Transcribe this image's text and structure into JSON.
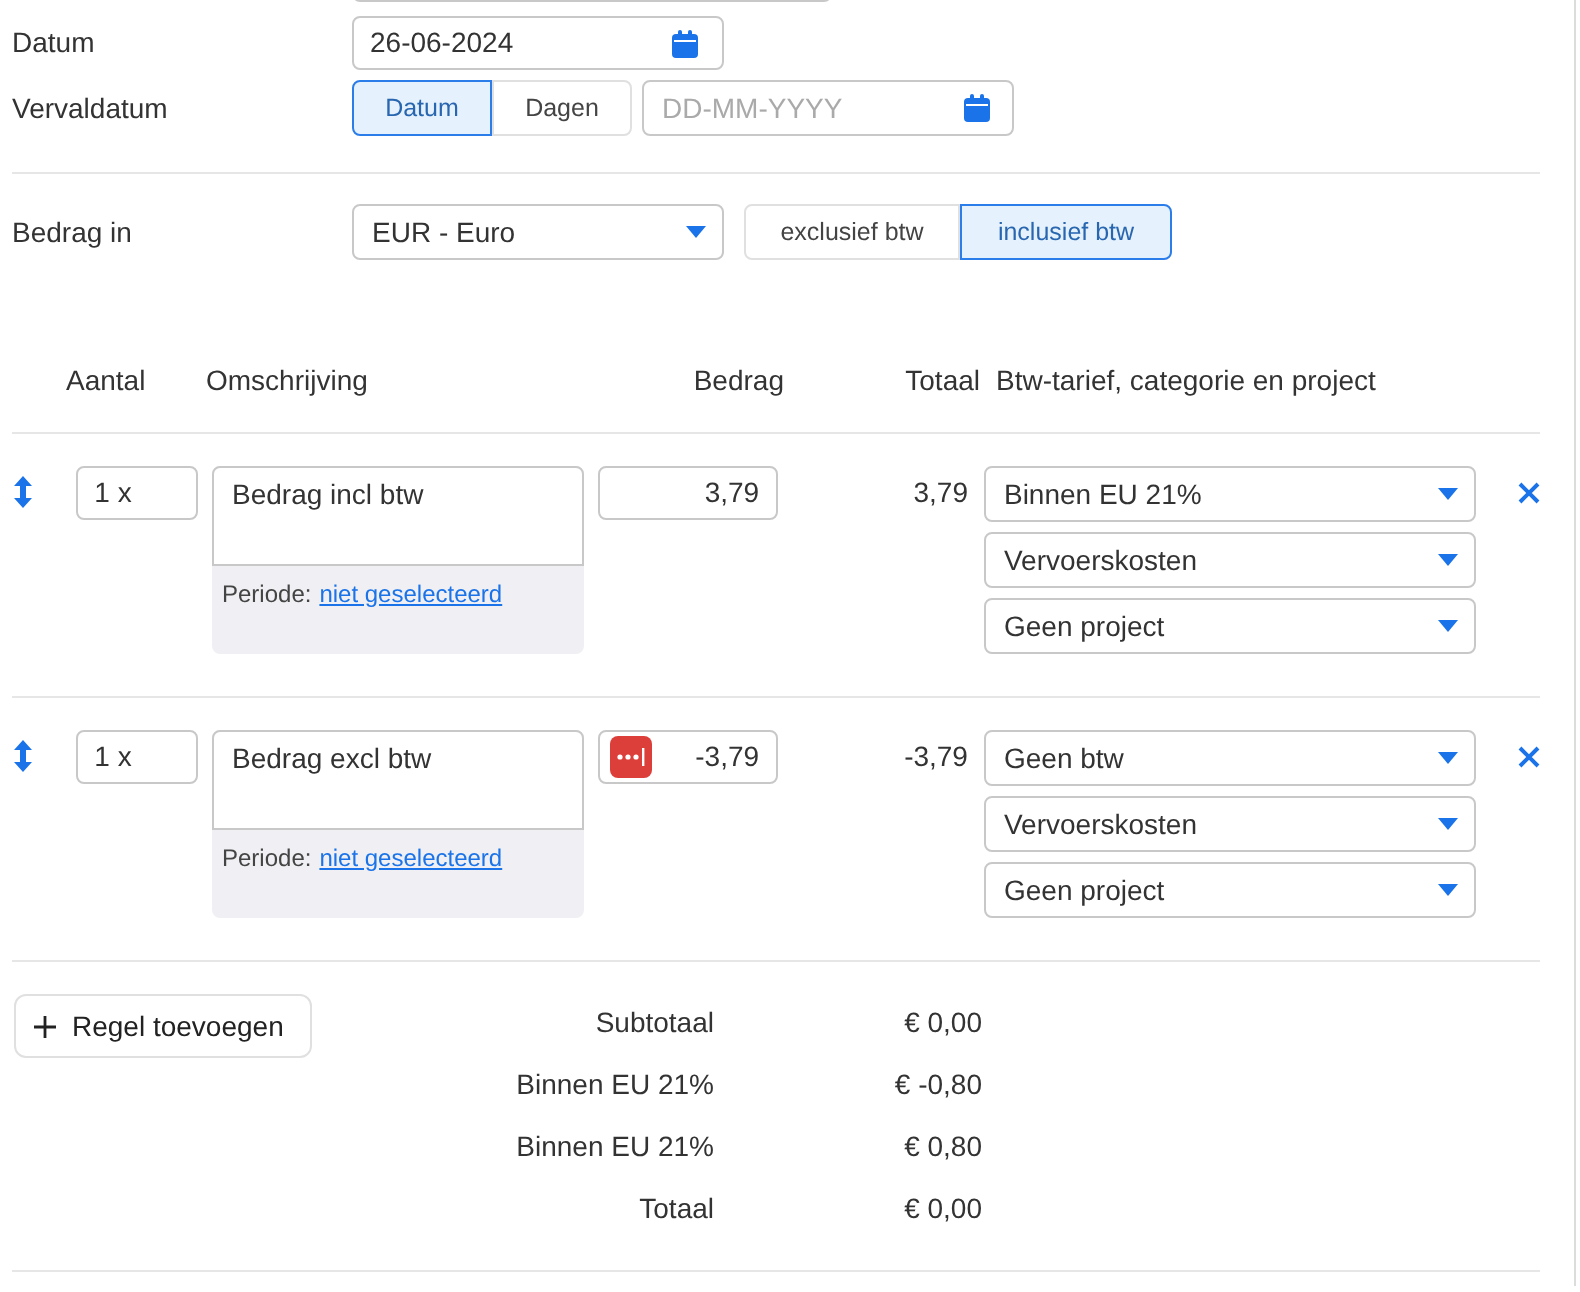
{
  "datum": {
    "label": "Datum",
    "value": "26-06-2024"
  },
  "vervaldatum": {
    "label": "Vervaldatum",
    "modes": [
      {
        "label": "Datum",
        "selected": true
      },
      {
        "label": "Dagen",
        "selected": false
      }
    ],
    "placeholder": "DD-MM-YYYY"
  },
  "bedrag_in": {
    "label": "Bedrag in",
    "currency": "EUR - Euro",
    "modes": [
      {
        "label": "exclusief btw",
        "selected": false
      },
      {
        "label": "inclusief btw",
        "selected": true
      }
    ]
  },
  "table": {
    "columns": [
      "Aantal",
      "Omschrijving",
      "Bedrag",
      "Totaal",
      "Btw-tarief, categorie en project"
    ],
    "rows": [
      {
        "quantity": "1 x",
        "description": "Bedrag incl btw",
        "period_label": "Periode:",
        "period_link": "niet geselecteerd",
        "amount": "3,79",
        "autofill_badge": false,
        "total": "3,79",
        "vat": "Binnen EU 21%",
        "category": "Vervoerskosten",
        "project": "Geen project"
      },
      {
        "quantity": "1 x",
        "description": "Bedrag excl btw",
        "period_label": "Periode:",
        "period_link": "niet geselecteerd",
        "amount": "-3,79",
        "autofill_badge": true,
        "total": "-3,79",
        "vat": "Geen btw",
        "category": "Vervoerskosten",
        "project": "Geen project"
      }
    ]
  },
  "add_line_button": "Regel toevoegen",
  "totals": [
    {
      "label": "Subtotaal",
      "value": "€ 0,00"
    },
    {
      "label": "Binnen EU 21%",
      "value": "€ -0,80"
    },
    {
      "label": "Binnen EU 21%",
      "value": "€ 0,80"
    },
    {
      "label": "Totaal",
      "value": "€ 0,00"
    }
  ]
}
